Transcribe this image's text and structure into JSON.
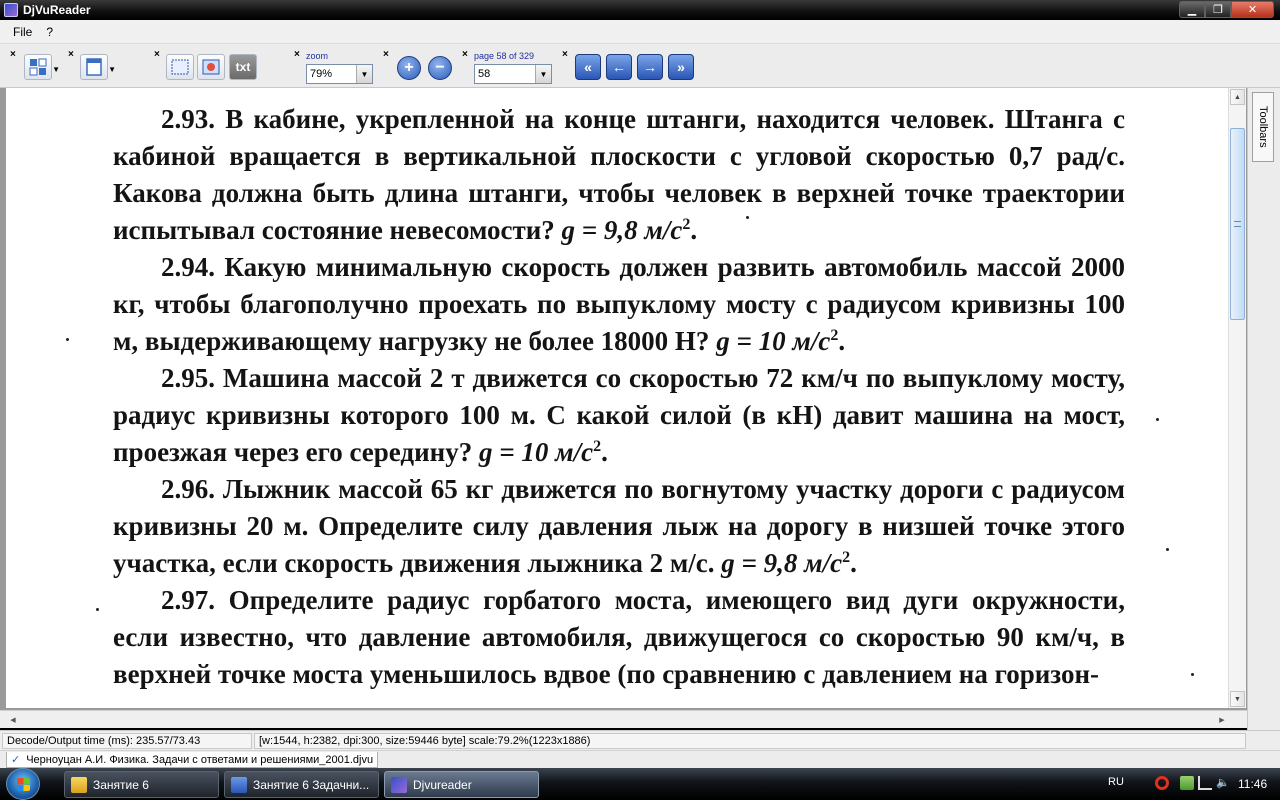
{
  "window": {
    "title": "DjVuReader"
  },
  "menu": {
    "items": [
      "File",
      "?"
    ]
  },
  "toolbar": {
    "zoom_label": "zoom",
    "zoom_value": "79%",
    "page_label": "page 58 of 329",
    "page_value": "58",
    "text_button": "txt"
  },
  "document": {
    "paragraphs": [
      {
        "num": "2.93.",
        "text": " В кабине, укрепленной на конце штанги, находится человек. Штанга с кабиной вращается в вертикальной плоскости с угловой скоростью 0,7 рад/с. Какова должна быть длина штанги, чтобы человек в верхней точке траектории испытывал состояние невесомости? ",
        "formula": "g = 9,8 м/с",
        "sup": "2",
        "tail": "."
      },
      {
        "num": "2.94.",
        "text": " Какую минимальную скорость должен развить автомобиль массой 2000 кг, чтобы благополучно проехать по выпуклому мосту с радиусом кривизны 100 м, выдерживающему нагрузку не более 18000 Н? ",
        "formula": "g = 10 м/с",
        "sup": "2",
        "tail": "."
      },
      {
        "num": "2.95.",
        "text": " Машина массой 2 т движется со скоростью 72 км/ч по выпуклому мосту, радиус кривизны которого 100 м. С какой силой (в кН) давит машина на мост, проезжая через его середину? ",
        "formula": "g = 10 м/с",
        "sup": "2",
        "tail": "."
      },
      {
        "num": "2.96.",
        "text": " Лыжник массой 65 кг движется по вогнутому участку дороги с радиусом кривизны 20 м. Определите силу давления лыж на дорогу в низшей точке этого участка, если скорость движения лыжника 2 м/с. ",
        "formula": "g = 9,8 м/с",
        "sup": "2",
        "tail": "."
      },
      {
        "num": "2.97.",
        "text": " Определите радиус горбатого моста, имеющего вид дуги окружности, если известно, что давление автомобиля, движущегося со скоростью 90 км/ч, в верхней точке моста уменьшилось вдвое (по сравнению с давлением на горизон-",
        "formula": "",
        "sup": "",
        "tail": ""
      }
    ]
  },
  "sidepanel": {
    "tab_label": "Toolbars"
  },
  "status": {
    "decode": "Decode/Output time (ms): 235.57/73.43",
    "info": "[w:1544, h:2382, dpi:300, size:59446 byte] scale:79.2%(1223x1886)"
  },
  "file_tab": {
    "name": "Черноуцан А.И. Физика. Задачи с ответами и решениями_2001.djvu"
  },
  "taskbar": {
    "tasks": [
      "Занятие 6",
      "Занятие 6 Задачни...",
      "Djvureader"
    ],
    "lang": "RU",
    "clock": "11:46"
  },
  "colors": {
    "accent": "#2a56b5",
    "title_bar": "#000000",
    "close": "#c8452c"
  }
}
